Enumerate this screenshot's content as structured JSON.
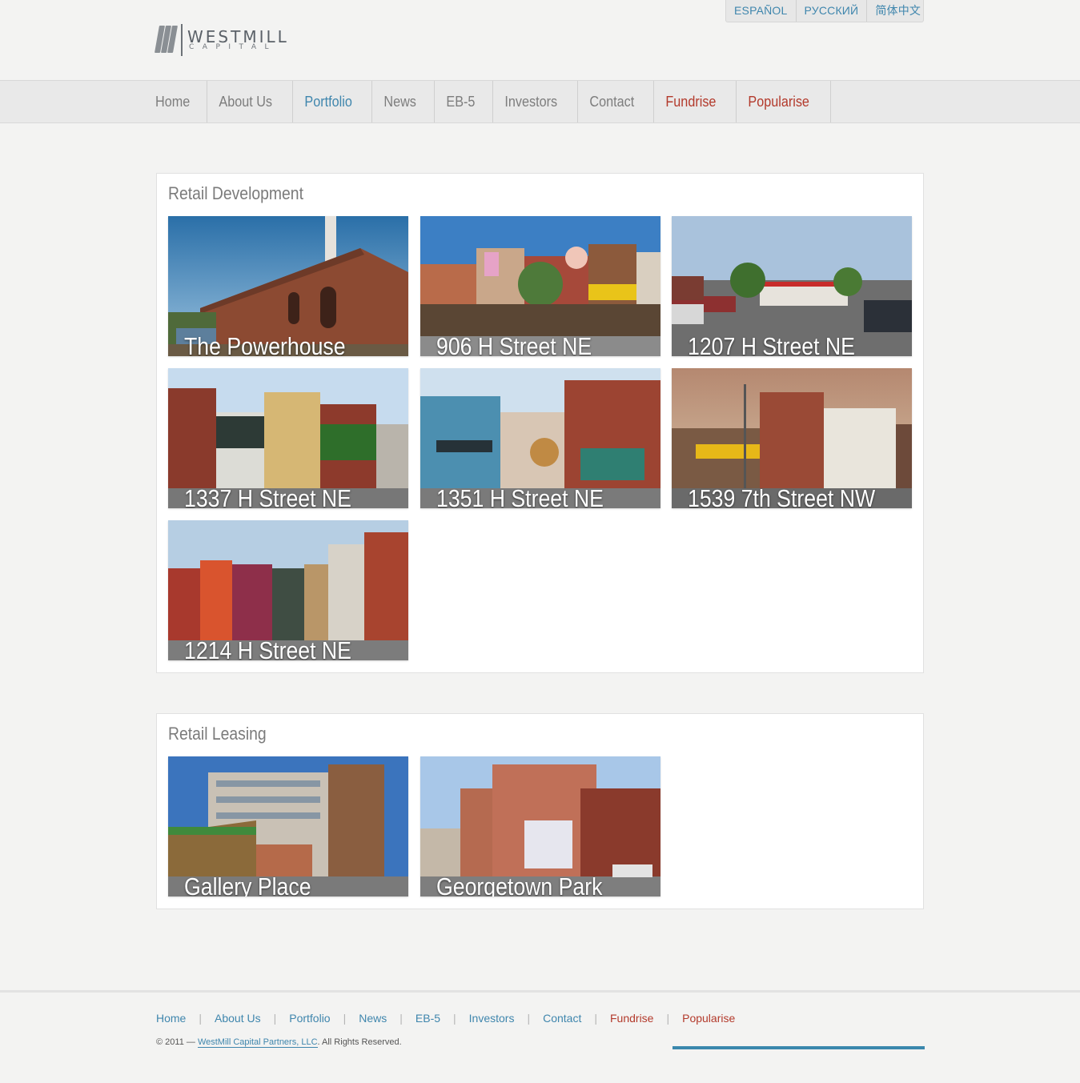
{
  "languages": [
    "ESPAÑOL",
    "РУССКИЙ",
    "简体中文"
  ],
  "logo": {
    "name": "WESTMILL",
    "sub": "CAPITAL"
  },
  "nav": {
    "items": [
      {
        "label": "Home"
      },
      {
        "label": "About Us"
      },
      {
        "label": "Portfolio"
      },
      {
        "label": "News"
      },
      {
        "label": "EB-5"
      },
      {
        "label": "Investors"
      },
      {
        "label": "Contact"
      },
      {
        "label": "Fundrise"
      },
      {
        "label": "Popularise"
      }
    ]
  },
  "sections": [
    {
      "title": "Retail Development",
      "properties": [
        "The Powerhouse",
        "906 H Street NE",
        "1207 H Street NE",
        "1337 H Street NE",
        "1351 H Street NE",
        "1539 7th Street NW",
        "1214 H Street NE"
      ]
    },
    {
      "title": "Retail Leasing",
      "properties": [
        "Gallery Place",
        "Georgetown Park"
      ]
    }
  ],
  "footer": {
    "nav": [
      "Home",
      "About Us",
      "Portfolio",
      "News",
      "EB-5",
      "Investors",
      "Contact",
      "Fundrise",
      "Popularise"
    ],
    "copyright_prefix": "© 2011 —",
    "copyright_link": "WestMill Capital Partners, LLC",
    "copyright_suffix": ". All Rights Reserved."
  },
  "colors": {
    "accent": "#3f86ad",
    "highlight": "#b33a2c"
  }
}
